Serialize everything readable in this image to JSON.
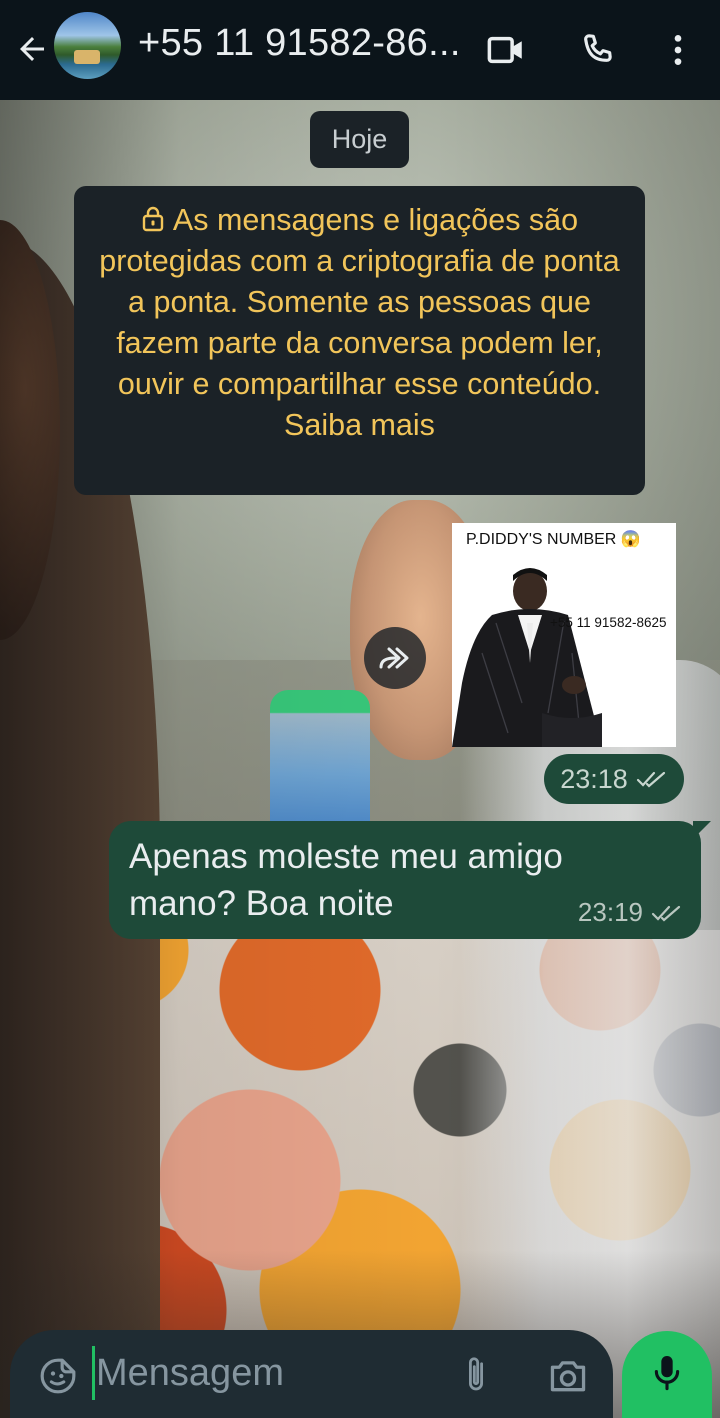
{
  "header": {
    "contact_name": "+55 11 91582-86...",
    "icons": [
      "back-arrow-icon",
      "video-call-icon",
      "voice-call-icon",
      "more-options-icon"
    ]
  },
  "chat": {
    "date_label": "Hoje",
    "encryption_notice": "As mensagens e ligações são protegidas com a criptografia de ponta a ponta. Somente as pessoas que fazem parte da conversa podem ler, ouvir e compartilhar esse conteúdo. Saiba mais",
    "messages": [
      {
        "type": "image",
        "image_caption": "P.DIDDY'S NUMBER 😱",
        "image_number_text": "+55 11 91582-8625",
        "time": "23:18",
        "status": "double-check-icon"
      },
      {
        "type": "text",
        "text": "Apenas moleste meu amigo mano? Boa noite",
        "time": "23:19",
        "status": "double-check-icon"
      }
    ]
  },
  "composer": {
    "placeholder": "Mensagem",
    "icons": [
      "sticker-icon",
      "attach-icon",
      "camera-icon",
      "microphone-icon"
    ]
  },
  "colors": {
    "header_bg": "#0b141a",
    "outgoing_bubble": "#1e4a39",
    "system_bubble": "#1b2227",
    "notice_text": "#f2c55a",
    "accent": "#21c063",
    "composer_bg": "#1f2c33"
  }
}
